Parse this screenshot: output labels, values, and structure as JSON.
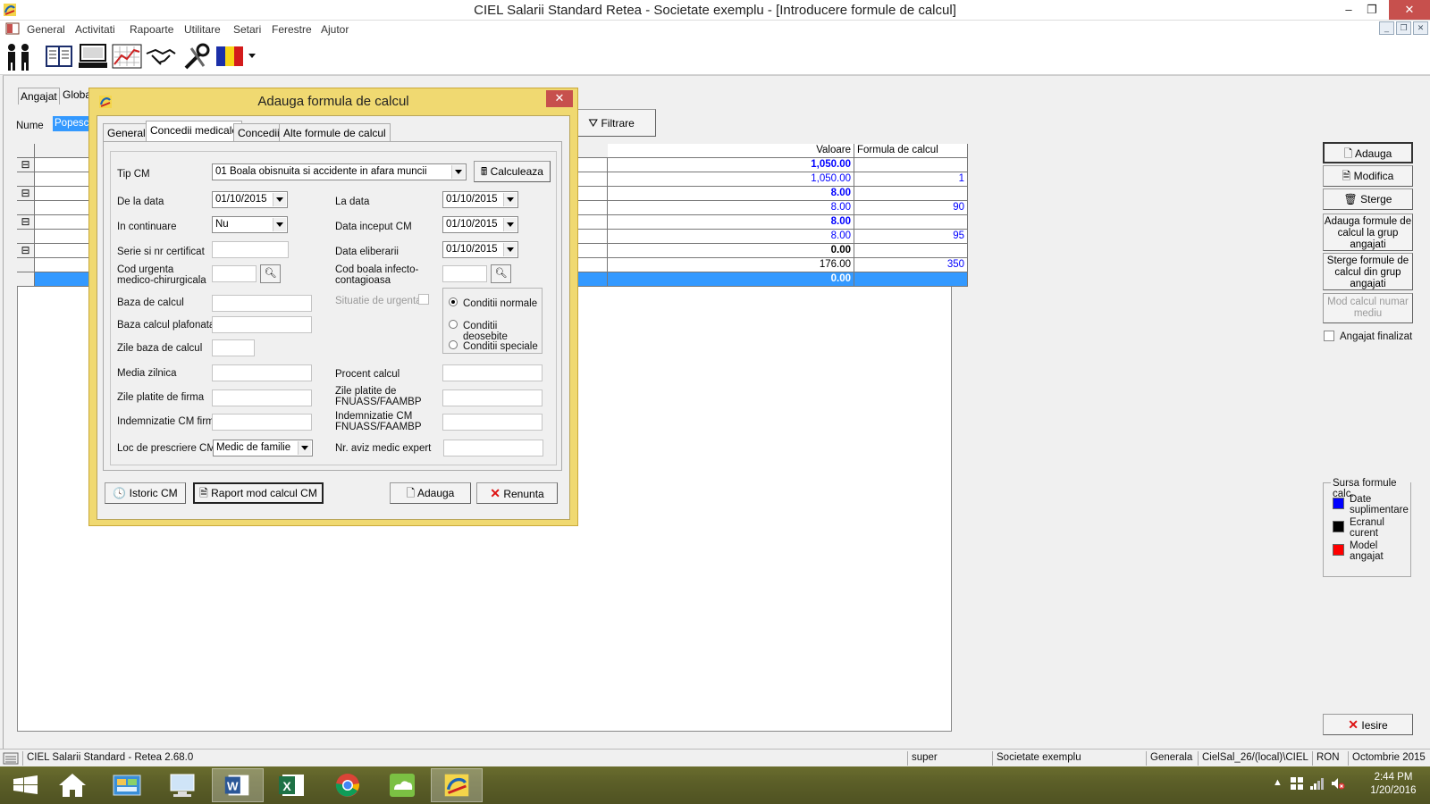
{
  "window": {
    "title": "CIEL Salarii Standard Retea - Societate exemplu - [Introducere formule de calcul]",
    "min": "–",
    "restore": "❐",
    "close": "✕"
  },
  "menu": {
    "items": [
      "General",
      "Activitati",
      "Rapoarte",
      "Utilitare",
      "Setari",
      "Ferestre",
      "Ajutor"
    ],
    "mdi_min": "_",
    "mdi_restore": "❐",
    "mdi_close": "✕"
  },
  "toolbar": {
    "icons": [
      "employees-icon",
      "register-book-icon",
      "computer-icon",
      "chart-icon",
      "handshake-icon",
      "tools-icon",
      "romania-flag-icon"
    ]
  },
  "main": {
    "tab_employee": "Angajat",
    "tab_global": "Globa",
    "name_label": "Nume",
    "name_value": "Popesc",
    "filter_button": "Filtrare",
    "grid_headers": {
      "value": "Valoare",
      "formula": "Formula de calcul"
    },
    "grid_rows": [
      {
        "value": "1,050.00",
        "formula": "",
        "bold": true,
        "color": "#0000ff",
        "expand": "⊟"
      },
      {
        "value": "1,050.00",
        "formula": "1",
        "bold": false,
        "color": "#0000ff",
        "expand": ""
      },
      {
        "value": "8.00",
        "formula": "",
        "bold": true,
        "color": "#0000ff",
        "expand": "⊟"
      },
      {
        "value": "8.00",
        "formula": "90",
        "bold": false,
        "color": "#0000ff",
        "expand": ""
      },
      {
        "value": "8.00",
        "formula": "",
        "bold": true,
        "color": "#0000ff",
        "expand": "⊟"
      },
      {
        "value": "8.00",
        "formula": "95",
        "bold": false,
        "color": "#0000ff",
        "expand": ""
      },
      {
        "value": "0.00",
        "formula": "",
        "bold": true,
        "color": "#000000",
        "expand": "⊟"
      },
      {
        "value": "176.00",
        "formula": "350",
        "bold": false,
        "color": "#000000",
        "expand": ""
      },
      {
        "value": "0.00",
        "formula": "",
        "bold": true,
        "color": "#ffffff",
        "expand": "",
        "selected": true
      }
    ]
  },
  "right_panel": {
    "add": "Adauga",
    "modify": "Modifica",
    "delete": "Sterge",
    "add_group": "Adauga formule de calcul la grup angajati",
    "delete_group": "Sterge formule de calcul din grup angajati",
    "mod_calc": "Mod calcul numar mediu",
    "employee_finalized": "Angajat finalizat",
    "source_title": "Sursa formule calc.",
    "legend": [
      {
        "label": "Date suplimentare",
        "color": "#0000ff"
      },
      {
        "label": "Ecranul curent",
        "color": "#000000"
      },
      {
        "label": "Model angajat",
        "color": "#ff0000"
      }
    ],
    "exit": "Iesire"
  },
  "dialog": {
    "title": "Adauga formula de calcul",
    "close": "✕",
    "tabs": [
      "General",
      "Concedii medicale",
      "Concedii",
      "Alte formule de calcul"
    ],
    "active_tab": 1,
    "fields": {
      "tip_cm_label": "Tip CM",
      "tip_cm_value": "01 Boala obisnuita si accidente in afara muncii",
      "calc_button": "Calculeaza",
      "de_la_data_label": "De la data",
      "de_la_data_value": "01/10/2015",
      "la_data_label": "La data",
      "la_data_value": "01/10/2015",
      "in_continuare_label": "In continuare",
      "in_continuare_value": "Nu",
      "data_inceput_label": "Data inceput CM",
      "data_inceput_value": "01/10/2015",
      "serie_label": "Serie si nr certificat",
      "data_eliberarii_label": "Data eliberarii",
      "data_eliberarii_value": "01/10/2015",
      "cod_urgenta_label": "Cod urgenta medico-chirurgicala",
      "cod_boala_label": "Cod boala infecto-contagioasa",
      "baza_calcul_label": "Baza de calcul",
      "situatie_urgenta_label": "Situatie de urgenta",
      "baza_plafonata_label": "Baza calcul plafonata",
      "zile_baza_label": "Zile baza de calcul",
      "media_zilnica_label": "Media zilnica",
      "procent_calcul_label": "Procent calcul",
      "zile_firma_label": "Zile platite de firma",
      "zile_fnuass_label": "Zile platite de FNUASS/FAAMBP",
      "indemn_firma_label": "Indemnizatie CM firma",
      "indemn_fnuass_label": "Indemnizatie CM FNUASS/FAAMBP",
      "loc_prescriere_label": "Loc de prescriere CM",
      "loc_prescriere_value": "Medic de familie",
      "nr_aviz_label": "Nr. aviz medic expert"
    },
    "conditions": [
      {
        "label": "Conditii normale",
        "selected": true
      },
      {
        "label": "Conditii deosebite",
        "selected": false
      },
      {
        "label": "Conditii speciale",
        "selected": false
      }
    ],
    "buttons": {
      "istoric": "Istoric CM",
      "raport": "Raport mod calcul CM",
      "adauga": "Adauga",
      "renunta": "Renunta"
    }
  },
  "statusbar": {
    "app": "CIEL Salarii Standard - Retea 2.68.0",
    "user": "super",
    "company": "Societate exemplu",
    "mode": "Generala",
    "db": "CielSal_26/(local)\\CIEL",
    "currency": "RON",
    "period": "Octombrie 2015"
  },
  "taskbar": {
    "time": "2:44 PM",
    "date": "1/20/2016",
    "apps": [
      "start-button",
      "home-icon",
      "control-panel-icon",
      "computer-icon",
      "word-icon",
      "excel-icon",
      "chrome-icon",
      "cloud-app-icon",
      "ciel-app-icon"
    ]
  }
}
